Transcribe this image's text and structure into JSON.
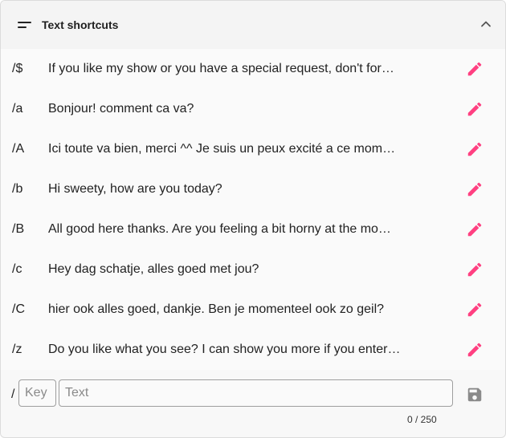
{
  "header": {
    "title": "Text shortcuts",
    "icon": "sort-lines-icon",
    "collapse_icon": "chevron-up-icon"
  },
  "accent_color": "#ff4081",
  "shortcuts": [
    {
      "key": "/$",
      "text": "If you like my show or you have a special request, don't for…"
    },
    {
      "key": "/a",
      "text": "Bonjour! comment ca va?"
    },
    {
      "key": "/A",
      "text": "Ici toute va bien, merci ^^ Je suis un peux excité a ce mom…"
    },
    {
      "key": "/b",
      "text": "Hi sweety, how are you today?"
    },
    {
      "key": "/B",
      "text": "All good here thanks. Are you feeling a bit horny at the mo…"
    },
    {
      "key": "/c",
      "text": "Hey dag schatje, alles goed met jou?"
    },
    {
      "key": "/C",
      "text": "hier ook alles goed, dankje. Ben je momenteel ook zo geil?"
    },
    {
      "key": "/z",
      "text": "Do you like what you see? I can show you more if you enter…"
    }
  ],
  "new_shortcut": {
    "prefix": "/",
    "key_placeholder": "Key",
    "text_placeholder": "Text",
    "key_value": "",
    "text_value": "",
    "counter": "0 / 250",
    "save_icon": "save-icon"
  }
}
